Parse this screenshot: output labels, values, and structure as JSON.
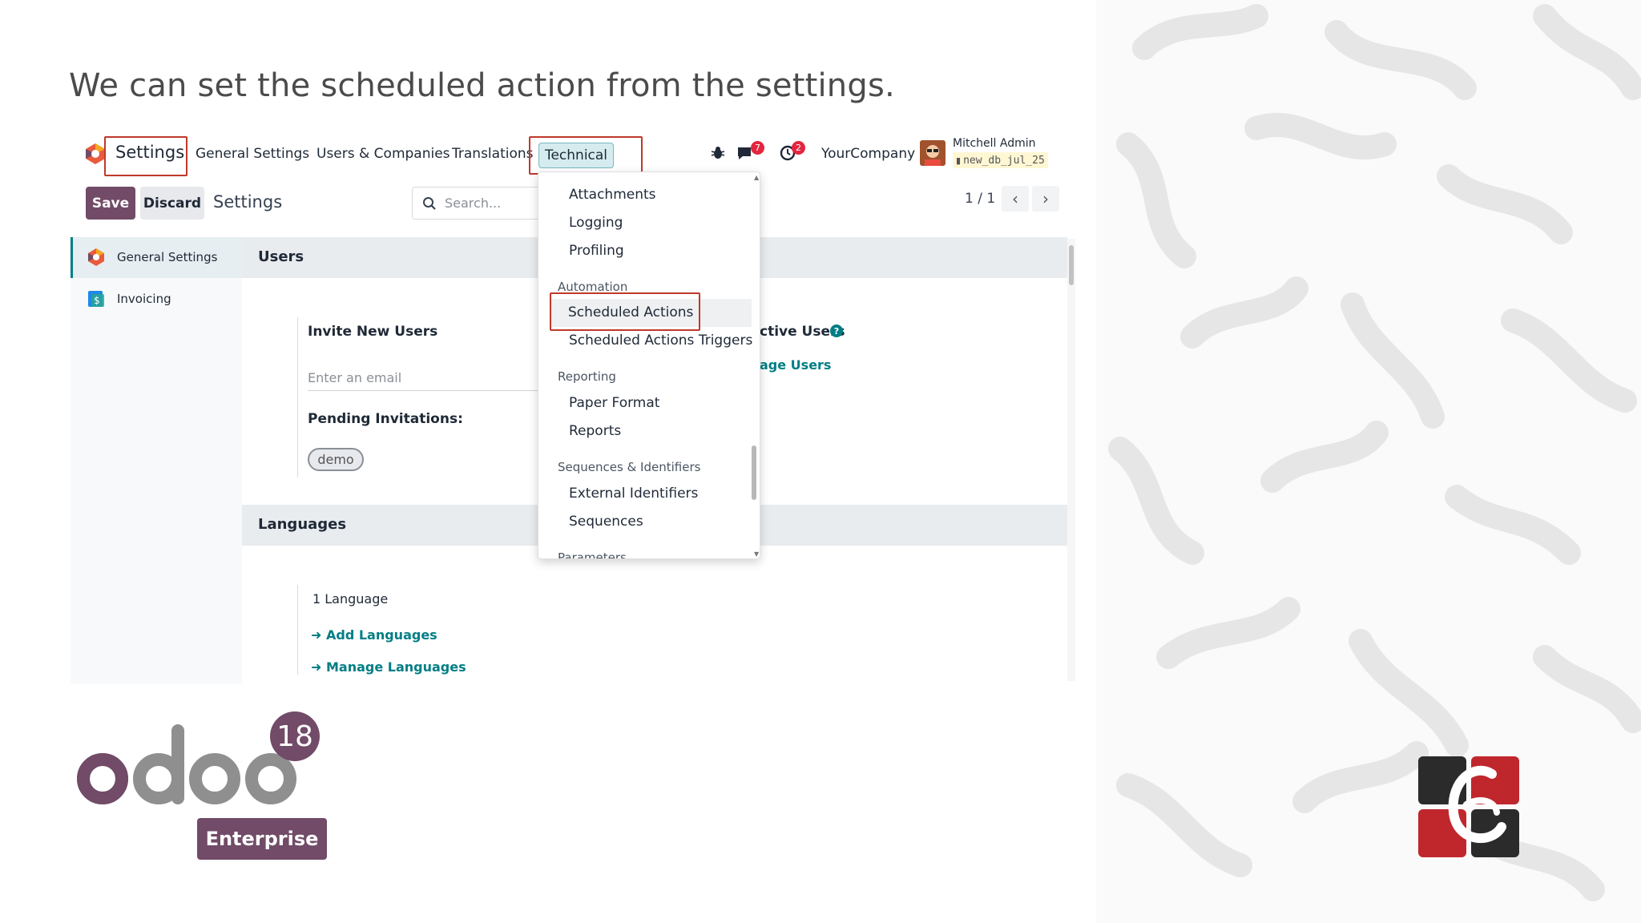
{
  "slide": {
    "heading": "We can set the scheduled action from the settings."
  },
  "navbar": {
    "app_title": "Settings",
    "menus": [
      "General Settings",
      "Users & Companies",
      "Translations"
    ],
    "active_menu": "Technical",
    "messages_count": "7",
    "activities_count": "2",
    "company": "YourCompany",
    "user_name": "Mitchell Admin",
    "db_name": "new_db_jul_25"
  },
  "control_panel": {
    "save_label": "Save",
    "discard_label": "Discard",
    "breadcrumb": "Settings",
    "search_placeholder": "Search...",
    "pager": "1 / 1"
  },
  "sidebar": {
    "items": [
      {
        "label": "General Settings",
        "icon": "odoo-settings-icon"
      },
      {
        "label": "Invoicing",
        "icon": "invoicing-icon"
      }
    ]
  },
  "users_section": {
    "title": "Users",
    "invite_label": "Invite New Users",
    "email_placeholder": "Enter an email",
    "pending_label": "Pending Invitations:",
    "pending_tag": "demo",
    "active_users_label": "ctive Users",
    "manage_users_link": "age Users"
  },
  "languages_section": {
    "title": "Languages",
    "count_label": "1 Language",
    "add_link": "Add Languages",
    "manage_link": "Manage Languages"
  },
  "technical_menu": {
    "items_top": [
      "Attachments",
      "Logging",
      "Profiling"
    ],
    "automation_group": "Automation",
    "automation_items": [
      "Scheduled Actions",
      "Scheduled Actions Triggers"
    ],
    "reporting_group": "Reporting",
    "reporting_items": [
      "Paper Format",
      "Reports"
    ],
    "sequences_group": "Sequences & Identifiers",
    "sequences_items": [
      "External Identifiers",
      "Sequences"
    ],
    "parameters_group": "Parameters"
  },
  "branding": {
    "odoo_version": "18",
    "edition": "Enterprise",
    "odoo_wordmark": "odoo",
    "accent_color": "#714b67",
    "highlight_color": "#c0392b",
    "teal_color": "#017e84"
  }
}
